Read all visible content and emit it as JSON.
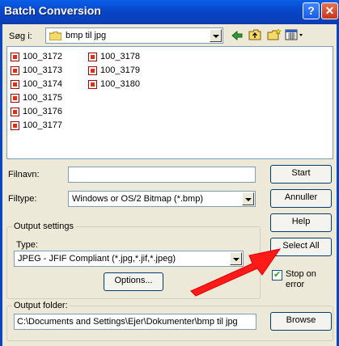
{
  "window": {
    "title": "Batch Conversion",
    "help_label": "?",
    "close_label": "✕"
  },
  "look_in": {
    "label": "Søg i:",
    "value": "bmp til jpg"
  },
  "toolbar": {
    "back": "back-icon",
    "up": "up-folder-icon",
    "new_folder": "new-folder-icon",
    "view": "view-menu-icon"
  },
  "files": [
    "100_3172",
    "100_3173",
    "100_3174",
    "100_3175",
    "100_3176",
    "100_3177",
    "100_3178",
    "100_3179",
    "100_3180"
  ],
  "filename": {
    "label": "Filnavn:",
    "value": ""
  },
  "filetype": {
    "label": "Filtype:",
    "value": "Windows or OS/2 Bitmap (*.bmp)"
  },
  "buttons": {
    "start": "Start",
    "cancel": "Annuller",
    "help": "Help",
    "select_all": "Select All",
    "options": "Options...",
    "browse": "Browse"
  },
  "output_settings": {
    "legend": "Output settings",
    "type_label": "Type:",
    "type_value": "JPEG - JFIF Compliant (*.jpg,*.jif,*.jpeg)"
  },
  "stop_on_error": {
    "label_line1": "Stop on",
    "label_line2": "error",
    "checked": true
  },
  "output_folder": {
    "legend": "Output folder:",
    "value": "C:\\Documents and Settings\\Ejer\\Dokumenter\\bmp til jpg"
  },
  "colors": {
    "titlebar": "#0846c8",
    "arrow": "#ff1a1a",
    "dialog_bg": "#ece9d8"
  }
}
